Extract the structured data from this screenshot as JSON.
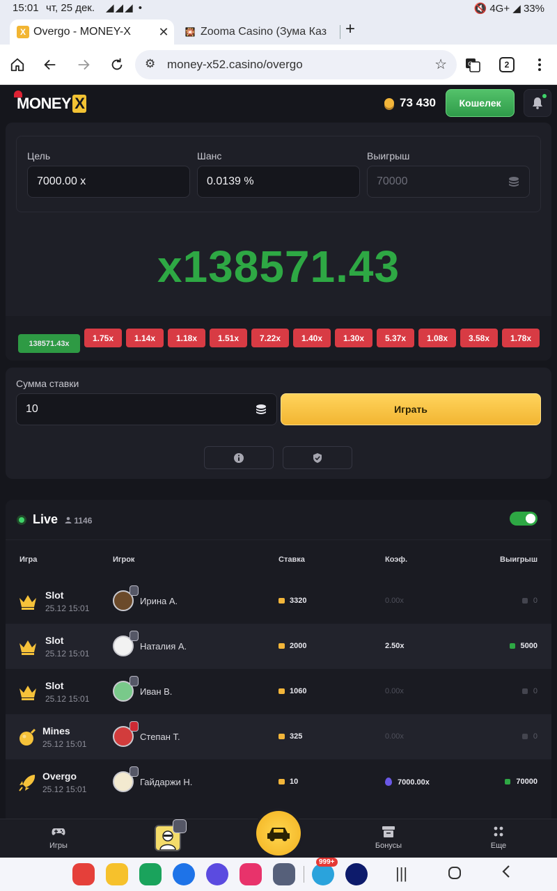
{
  "status_bar": {
    "time": "15:01",
    "date": "чт, 25 дек.",
    "telegram_icons": "◢◢◢ •",
    "right": "🔇 4G+ ◢ 33%"
  },
  "tabs": [
    {
      "title": "Overgo - MONEY-X",
      "favicon": "X"
    },
    {
      "title": "Zooma Casino (Зума Каз",
      "favicon": "🎇"
    }
  ],
  "browser": {
    "url": "money-x52.casino/overgo",
    "tab_count": "2"
  },
  "header": {
    "logo": "MONEY",
    "logo_x": "X",
    "balance": "73 430",
    "wallet": "Кошелек"
  },
  "game": {
    "target_label": "Цель",
    "target_value": "7000.00 x",
    "chance_label": "Шанс",
    "chance_value": "0.0139 %",
    "payout_label": "Выигрыш",
    "payout_value": "70000",
    "result": "x138571.43",
    "history": [
      {
        "label": "138571.43x",
        "status": "win"
      },
      {
        "label": "1.75x",
        "status": "lose"
      },
      {
        "label": "1.14x",
        "status": "lose"
      },
      {
        "label": "1.18x",
        "status": "lose"
      },
      {
        "label": "1.51x",
        "status": "lose"
      },
      {
        "label": "7.22x",
        "status": "lose"
      },
      {
        "label": "1.40x",
        "status": "lose"
      },
      {
        "label": "1.30x",
        "status": "lose"
      },
      {
        "label": "5.37x",
        "status": "lose"
      },
      {
        "label": "1.08x",
        "status": "lose"
      },
      {
        "label": "3.58x",
        "status": "lose"
      },
      {
        "label": "1.78x",
        "status": "lose"
      }
    ]
  },
  "bet": {
    "label": "Сумма ставки",
    "value": "10",
    "play": "Играть"
  },
  "live": {
    "title": "Live",
    "online": "1146",
    "columns": {
      "game": "Игра",
      "player": "Игрок",
      "stake": "Ставка",
      "coef": "Коэф.",
      "win": "Выигрыш"
    },
    "rows": [
      {
        "game": "Slot",
        "icon": "crown-icon",
        "time": "25.12 15:01",
        "player": "Ирина А.",
        "stake": "3320",
        "coef": "0.00x",
        "win": "0"
      },
      {
        "game": "Slot",
        "icon": "crown-icon",
        "time": "25.12 15:01",
        "player": "Наталия А.",
        "stake": "2000",
        "coef": "2.50x",
        "win": "5000"
      },
      {
        "game": "Slot",
        "icon": "crown-icon",
        "time": "25.12 15:01",
        "player": "Иван В.",
        "stake": "1060",
        "coef": "0.00x",
        "win": "0"
      },
      {
        "game": "Mines",
        "icon": "bomb-icon",
        "time": "25.12 15:01",
        "player": "Степан Т.",
        "stake": "325",
        "coef": "0.00x",
        "win": "0"
      },
      {
        "game": "Overgo",
        "icon": "rocket-icon",
        "time": "25.12 15:01",
        "player": "Гайдаржи Н.",
        "stake": "10",
        "coef": "7000.00x",
        "win": "70000"
      }
    ]
  },
  "bottom_nav": {
    "games": "Игры",
    "bonuses": "Бонусы",
    "more": "Еще"
  },
  "colors": {
    "bg": "#15161c",
    "panel": "#1e1f27",
    "accent_green": "#2ea844",
    "accent_yellow": "#f2b532",
    "loss_red": "#d83b44"
  },
  "android_badge": "999+"
}
